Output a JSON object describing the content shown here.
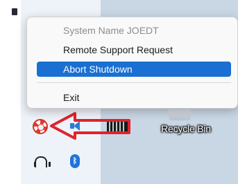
{
  "context_menu": {
    "items": [
      {
        "label": "System Name JOEDT",
        "disabled": true
      },
      {
        "label": "Remote Support Request",
        "disabled": false
      },
      {
        "label": "Abort Shutdown",
        "highlighted": true
      },
      {
        "label": "Exit",
        "disabled": false
      }
    ]
  },
  "desktop": {
    "recycle_bin_label": "Recycle Bin"
  },
  "tray_icons": [
    "lifebuoy-icon",
    "volume-icon",
    "headset-icon",
    "bluetooth-icon"
  ],
  "bluetooth_glyph": "ᛒ",
  "colors": {
    "highlight": "#1a6fd2",
    "annotation_arrow": "#e0232e",
    "desktop": "#c9d7e5"
  }
}
